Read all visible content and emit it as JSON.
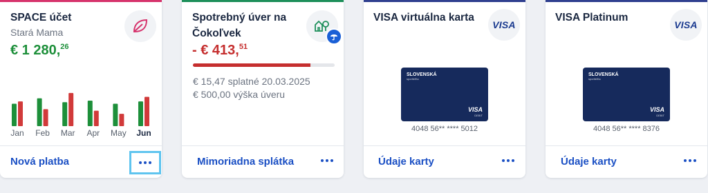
{
  "accent_colors": {
    "card1": "#d6336c",
    "card2": "#1d8f5a",
    "card3": "#2f3f8f",
    "card4": "#2f3f8f"
  },
  "card1": {
    "title": "SPACE účet",
    "subtitle": "Stará Mama",
    "amount_main": "€ 1 280,",
    "amount_cents": "26",
    "amount_color": "#1d8f3a",
    "icon": "leaf-icon",
    "months": [
      "Jan",
      "Feb",
      "Mar",
      "Apr",
      "May",
      "Jun"
    ],
    "current_month": "Jun",
    "action": "Nová platba"
  },
  "card2": {
    "title_line1": "Spotrebný úver na",
    "title_line2": "Čokoľvek",
    "amount_main": "- € 413,",
    "amount_cents": "51",
    "amount_color": "#c52e2e",
    "icon": "house-tree-icon",
    "repaid_fraction": 0.83,
    "installment": "€ 15,47 splatné 20.03.2025",
    "loan_amount": "€ 500,00 výška úveru",
    "action": "Mimoriadna splátka"
  },
  "card3": {
    "title": "VISA virtuálna karta",
    "logo_text": "VISA",
    "bank_name": "SLOVENSKÁ",
    "bank_sub": "sporiteľňa",
    "card_brand": "VISA",
    "card_type": "DEBIT",
    "card_number": "4048 56** **** 5012",
    "action": "Údaje karty"
  },
  "card4": {
    "title": "VISA Platinum",
    "logo_text": "VISA",
    "bank_name": "SLOVENSKÁ",
    "bank_sub": "sporiteľňa",
    "card_brand": "VISA",
    "card_type": "DEBIT",
    "card_number": "4048 56** **** 8376",
    "action": "Údaje karty"
  },
  "chart_data": {
    "type": "bar",
    "categories": [
      "Jan",
      "Feb",
      "Mar",
      "Apr",
      "May",
      "Jun"
    ],
    "series": [
      {
        "values": [
          0.58,
          0.72,
          0.62,
          0.66,
          0.58,
          0.64
        ],
        "color": "#1d8f3a"
      },
      {
        "values": [
          0.64,
          0.44,
          0.86,
          0.4,
          0.32,
          0.76
        ],
        "color": "#d13a3a"
      }
    ]
  }
}
